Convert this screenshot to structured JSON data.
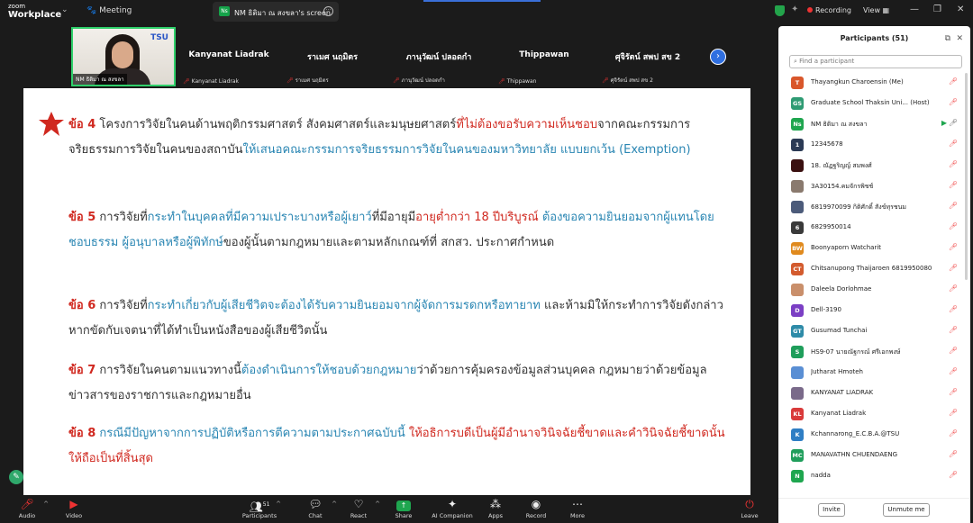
{
  "app": {
    "brand_top": "zoom",
    "brand_name": "Workplace",
    "meeting_label": "Meeting",
    "share_tab_badge": "Ns",
    "share_tab_label": "NM ธิติมา ณ สงขลา's screen",
    "recording_label": "Recording",
    "view_label": "View"
  },
  "video_strip": {
    "self_name": "NM ธิติมา ณ สงขลา",
    "self_logo": "TSU",
    "tiles": [
      {
        "big": "Kanyanat Liadrak",
        "small": "Kanyanat Liadrak"
      },
      {
        "big": "ราเมศ นฤมิตร",
        "small": "ราเมศ นฤมิตร"
      },
      {
        "big": "ภานุวัฒน์ ปลอดกำ",
        "small": "ภานุวัฒน์ ปลอดกำ"
      },
      {
        "big": "Thippawan",
        "small": "Thippawan"
      },
      {
        "big": "ศุจิรัตน์ สพป สข 2",
        "small": "ศุจิรัตน์ สพป สข 2"
      }
    ]
  },
  "slide": {
    "p4": {
      "kw": "ข้อ 4",
      "a": " โครงการวิจัยในคนด้านพฤติกรรมศาสตร์ สังคมศาสตร์และมนุษยศาสตร์",
      "b": "ที่ไม่ต้องขอรับความเห็นชอบ",
      "c": "จากคณะกรรมการจริยธรรมการวิจัยในคนของสถาบัน",
      "d": "ให้เสนอคณะกรรมการจริยธรรมการวิจัยในคนของมหาวิทยาลัย แบบยกเว้น (Exemption)"
    },
    "p5": {
      "kw": "ข้อ 5",
      "a": " การวิจัยที่",
      "b": "กระทำในบุคคลที่มีความเปราะบางหรือผู้เยาว์",
      "c": "ที่มีอายุมี",
      "d": "อายุต่ำกว่า 18 ปีบริบูรณ์",
      "e": " ต้องขอความยินยอมจากผู้แทนโดยชอบธรรม ผู้อนุบาลหรือผู้พิทักษ์",
      "f": "ของผู้นั้นตามกฎหมายและตามหลักเกณฑ์ที่ สกสว. ประกาศกำหนด"
    },
    "p6": {
      "kw": "ข้อ 6",
      "a": " การวิจัยที่",
      "b": "กระทำเกี่ยวกับผู้เสียชีวิตจะต้องได้รับความยินยอมจากผู้จัดการมรดกหรือทายาท",
      "c": " และห้ามมิให้กระทำการวิจัยดังกล่าวหากขัดกับเจตนาที่ได้ทำเป็นหนังสือของผู้เสียชีวิตนั้น"
    },
    "p7": {
      "kw": "ข้อ 7",
      "a": " การวิจัยในคนตามแนวทางนี้",
      "b": "ต้องดำเนินการให้ชอบด้วยกฎหมาย",
      "c": "ว่าด้วยการคุ้มครองข้อมูลส่วนบุคคล กฎหมายว่าด้วยข้อมูลข่าวสารของราชการและกฎหมายอื่น"
    },
    "p8": {
      "kw": "ข้อ 8",
      "a": " กรณีมีปัญหาจากการปฏิบัติหรือการตีความตามประกาศฉบับนี้",
      "b": " ให้อธิการบดีเป็นผู้มีอำนาจวินิจฉัยชี้ขาดและคำวินิจฉัยชี้ขาดนั้นให้ถือเป็นที่สิ้นสุด"
    }
  },
  "toolbar": {
    "audio": "Audio",
    "video": "Video",
    "participants": "Participants",
    "participants_count": "51",
    "chat": "Chat",
    "react": "React",
    "share": "Share",
    "ai": "AI Companion",
    "apps": "Apps",
    "record": "Record",
    "more": "More",
    "leave": "Leave"
  },
  "panel": {
    "title": "Participants (51)",
    "search_placeholder": "Find a participant",
    "invite": "Invite",
    "unmute": "Unmute me",
    "participants": [
      {
        "initial": "T",
        "color": "#d9572b",
        "name": "Thayangkun Charoensin (Me)"
      },
      {
        "initial": "GS",
        "color": "#2f9b73",
        "name": "Graduate School Thaksin Uni... (Host)"
      },
      {
        "initial": "Ns",
        "color": "#1fa64f",
        "name": "NM ธิติมา ณ สงขลา"
      },
      {
        "initial": "1",
        "color": "#2b3a55",
        "name": "12345678"
      },
      {
        "initial": "",
        "color": "#3a1010",
        "name": "18. ณัฏฐริญญ์ สมพงศ์"
      },
      {
        "initial": "",
        "color": "#8a7a6e",
        "name": "3A30154.คมจักรพิชช์"
      },
      {
        "initial": "",
        "color": "#4c5b7a",
        "name": "6819970099 กิติศักดิ์ สังข์ทุรชนม"
      },
      {
        "initial": "6",
        "color": "#3a3a3a",
        "name": "6829950014"
      },
      {
        "initial": "BW",
        "color": "#e08a1e",
        "name": "Boonyaporn Watcharit"
      },
      {
        "initial": "CT",
        "color": "#d35b2e",
        "name": "Chitsanupong Thaijaroen 6819950080"
      },
      {
        "initial": "",
        "color": "#c98f6b",
        "name": "Daleela Dorlohmae"
      },
      {
        "initial": "D",
        "color": "#7b3fc4",
        "name": "Dell-3190"
      },
      {
        "initial": "GT",
        "color": "#2e8ba8",
        "name": "Gusumad Tunchai"
      },
      {
        "initial": "S",
        "color": "#1f9e5b",
        "name": "HS9-07 นายณัฐกรณ์ ศรีเอกพงษ์"
      },
      {
        "initial": "",
        "color": "#5a8fd4",
        "name": "Jutharat Hmoteh"
      },
      {
        "initial": "",
        "color": "#7a6a8a",
        "name": "KANYANAT LIADRAK"
      },
      {
        "initial": "KL",
        "color": "#d93a3a",
        "name": "Kanyanat Liadrak"
      },
      {
        "initial": "K",
        "color": "#2f7ec4",
        "name": "Kchannarong_E.C.B.A.@TSU"
      },
      {
        "initial": "MC",
        "color": "#1f9e5b",
        "name": "MANAVATHN CHUENDAENG"
      },
      {
        "initial": "N",
        "color": "#1fa64f",
        "name": "nadda"
      }
    ]
  },
  "colors": {
    "accent": "#2f6fe0",
    "keyword_red": "#d0281f",
    "highlight_blue": "#2a86b3",
    "share_green": "#1fa64f"
  }
}
